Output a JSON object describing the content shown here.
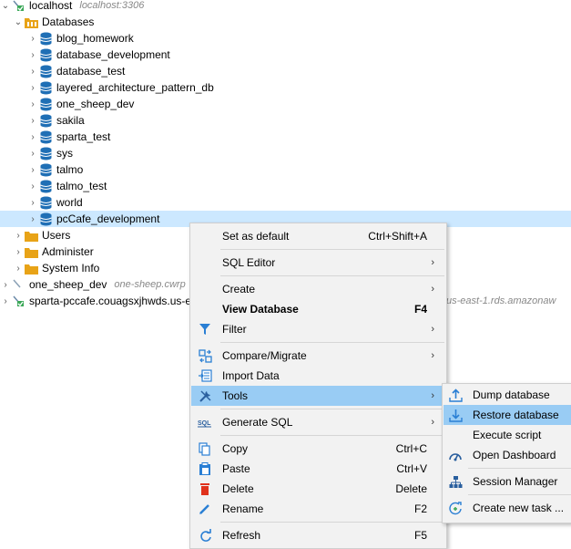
{
  "tree": {
    "connection": {
      "name": "localhost",
      "host": "localhost:3306"
    },
    "databases_label": "Databases",
    "databases": [
      "blog_homework",
      "database_development",
      "database_test",
      "layered_architecture_pattern_db",
      "one_sheep_dev",
      "sakila",
      "sparta_test",
      "sys",
      "talmo",
      "talmo_test",
      "world",
      "pcCafe_development"
    ],
    "folders": [
      "Users",
      "Administer",
      "System Info"
    ],
    "connection2": {
      "name": "one_sheep_dev",
      "host": "one-sheep.cwrp"
    },
    "connection3": {
      "name": "sparta-pccafe.couagsxjhwds.us-e",
      "host_tail": "us-east-1.rds.amazonaw"
    }
  },
  "menu": {
    "items": [
      {
        "label": "Set as default",
        "shortcut": "Ctrl+Shift+A",
        "icon": "none"
      },
      {
        "label": "SQL Editor",
        "arrow": "›",
        "icon": "none"
      },
      {
        "label": "Create",
        "arrow": "›",
        "icon": "none"
      },
      {
        "label": "View Database",
        "shortcut": "F4",
        "icon": "none"
      },
      {
        "label": "Filter",
        "arrow": "›",
        "icon": "filter-icon"
      },
      {
        "label": "Compare/Migrate",
        "arrow": "›",
        "icon": "compare-icon"
      },
      {
        "label": "Import Data",
        "icon": "import-icon"
      },
      {
        "label": "Tools",
        "arrow": "›",
        "icon": "tools-icon"
      },
      {
        "label": "Generate SQL",
        "arrow": "›",
        "icon": "sql-icon"
      },
      {
        "label": "Copy",
        "shortcut": "Ctrl+C",
        "icon": "copy-icon"
      },
      {
        "label": "Paste",
        "shortcut": "Ctrl+V",
        "icon": "paste-icon"
      },
      {
        "label": "Delete",
        "shortcut": "Delete",
        "icon": "delete-icon"
      },
      {
        "label": "Rename",
        "shortcut": "F2",
        "icon": "rename-icon"
      },
      {
        "label": "Refresh",
        "shortcut": "F5",
        "icon": "refresh-icon"
      }
    ]
  },
  "submenu": {
    "items": [
      {
        "label": "Dump database",
        "icon": "dump-icon"
      },
      {
        "label": "Restore database",
        "icon": "restore-icon"
      },
      {
        "label": "Execute script",
        "icon": "none"
      },
      {
        "label": "Open Dashboard",
        "icon": "dashboard-icon"
      },
      {
        "label": "Session Manager",
        "icon": "session-icon"
      },
      {
        "label": "Create new task ...",
        "icon": "task-icon"
      }
    ]
  },
  "colors": {
    "selection": "#cce8ff",
    "menu_hover": "#99ccf4",
    "db_icon": "#1f6fb5",
    "folder_icon": "#e8a317"
  }
}
